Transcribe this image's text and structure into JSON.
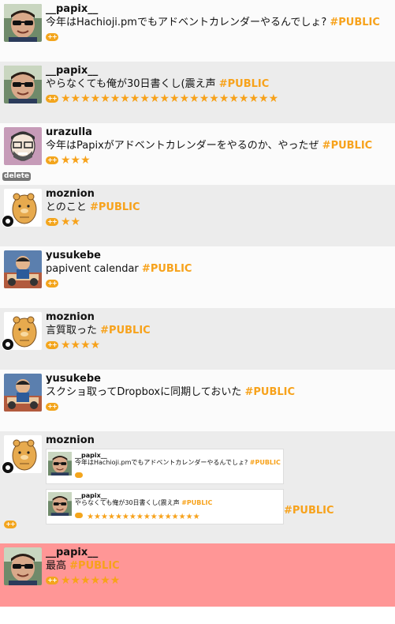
{
  "posts": [
    {
      "user": "__papix__",
      "text": "今年はHachioji.pmでもアドベントカレンダーやるんでしょ?",
      "tag": "#PUBLIC",
      "stars": "",
      "plus": "++"
    },
    {
      "user": "__papix__",
      "text": "やらなくても俺が30日書くし(震え声",
      "tag": "#PUBLIC",
      "stars": "★★★★★★★★★★★★★★★★★★★★★★",
      "plus": "++"
    },
    {
      "user": "urazulla",
      "text": "今年はPapixがアドベントカレンダーをやるのか、やったぜ",
      "tag": "#PUBLIC",
      "stars": "★★★",
      "plus": "++",
      "delete_label": "delete"
    },
    {
      "user": "moznion",
      "text": "とのこと",
      "tag": "#PUBLIC",
      "stars": "★★",
      "plus": "++"
    },
    {
      "user": "yusukebe",
      "text": "papivent calendar",
      "tag": "#PUBLIC",
      "stars": "",
      "plus": "++"
    },
    {
      "user": "moznion",
      "text": "言質取った",
      "tag": "#PUBLIC",
      "stars": "★★★★",
      "plus": "++"
    },
    {
      "user": "yusukebe",
      "text": "スクショ取ってDropboxに同期しておいた",
      "tag": "#PUBLIC",
      "stars": "",
      "plus": "++"
    },
    {
      "user": "moznion",
      "tag": "#PUBLIC",
      "plus": "++",
      "quotes": [
        {
          "user": "__papix__",
          "text": "今年はHachioji.pmでもアドベントカレンダーやるんでしょ?",
          "tag": "#PUBLIC",
          "stars": ""
        },
        {
          "user": "__papix__",
          "text": "やらなくても俺が30日書くし(震え声",
          "tag": "#PUBLIC",
          "stars": "★★★★★★★★★★★★★★★★"
        }
      ]
    },
    {
      "user": "__papix__",
      "text": "最高",
      "tag": "#PUBLIC",
      "stars": "★★★★★★",
      "plus": "++"
    }
  ],
  "colors": {
    "accent": "#f7a21b",
    "highlight": "#ff9696",
    "row_alt": "#ececec"
  }
}
